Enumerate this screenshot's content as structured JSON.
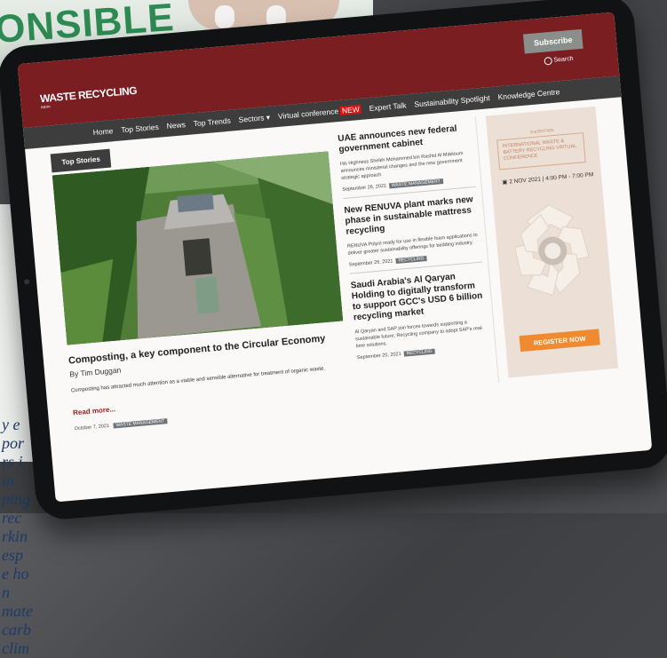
{
  "magazine": {
    "headline": "ONSIBLE",
    "body_lines": [
      "y e",
      "por",
      "rs i",
      "in",
      "ping",
      "rec",
      "rkin",
      "esp",
      "e ho",
      "n",
      "mate",
      "carb",
      "clim"
    ]
  },
  "site": {
    "logo": "WASTE RECYCLING",
    "logo_sub": "INDIA",
    "subscribe_label": "Subscribe",
    "search_label": "Search"
  },
  "nav": {
    "items": [
      "Home",
      "Top Stories",
      "News",
      "Top Trends",
      "Sectors ▾",
      "Virtual conference",
      "Expert Talk",
      "Sustainability Spotlight",
      "Knowledge Centre"
    ],
    "new_badge": "NEW"
  },
  "section_tab": "Top Stories",
  "main_story": {
    "title": "Composting, a key component to the Circular Economy",
    "byline": "By Tim Duggan",
    "description": "Composting has attracted much attention as a viable and sensible alternative for treatment of organic waste.",
    "read_more": "Read more...",
    "date": "October 7, 2021",
    "tag": "WASTE MANAGEMENT"
  },
  "side_articles": [
    {
      "title": "UAE announces new federal government cabinet",
      "summary": "His Highness Sheikh Mohammed bin Rashid Al Maktoum announces ministerial changes and the new government strategic approach",
      "date": "September 26, 2021",
      "tag": "WASTE MANAGEMENT"
    },
    {
      "title": "New RENUVA plant marks new phase in sustainable mattress recycling",
      "summary": "RENUVA Polyol ready for use in flexible foam applications to deliver greater sustainability offerings for bedding industry.",
      "date": "September 26, 2021",
      "tag": "RECYCLING"
    },
    {
      "title": "Saudi Arabia's Al Qaryan Holding to digitally transform to support GCC's USD 6 billion recycling market",
      "summary": "Al Qaryan and SAP join forces towards supporting a sustainable future; Recycling company to adopt SAP's real-time solutions.",
      "date": "September 20, 2021",
      "tag": "RECYCLING"
    }
  ],
  "ad": {
    "edition": "2nd EDITION",
    "title": "INTERNATIONAL WASTE & BATTERY RECYCLING VIRTUAL CONFERENCE",
    "date_time": "2 NOV 2021 | 4:00 PM - 7:00 PM",
    "button_label": "REGISTER NOW"
  },
  "colors": {
    "header": "#7a1e22",
    "nav": "#3d3d3d",
    "accent": "#f08a30",
    "magazine_green": "#2d8a52"
  }
}
